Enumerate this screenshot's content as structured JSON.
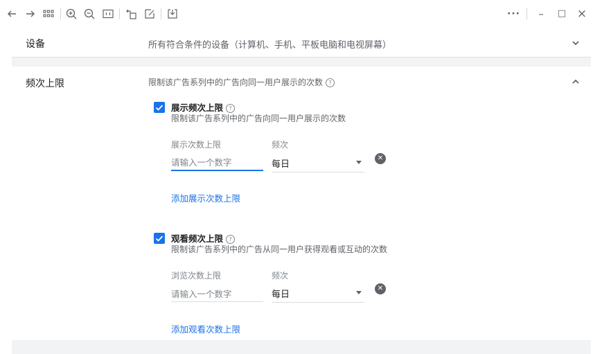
{
  "toolbar": {
    "back_icon": "arrow-left-icon",
    "forward_icon": "arrow-right-icon",
    "grid_icon": "grid-icon",
    "zoom_in_icon": "zoom-in-icon",
    "zoom_out_icon": "zoom-out-icon",
    "fit_icon": "fit-screen-icon",
    "rotate_icon": "rotate-icon",
    "edit_icon": "edit-icon",
    "save_icon": "save-icon",
    "more": "···",
    "minimize": "–",
    "maximize": "□",
    "close": "×"
  },
  "device_section": {
    "title": "设备",
    "description": "所有符合条件的设备（计算机、手机、平板电脑和电视屏幕）"
  },
  "frequency_section": {
    "title": "频次上限",
    "description": "限制该广告系列中的广告向同一用户展示的次数",
    "help": "?",
    "impression_cap": {
      "checked": true,
      "title": "展示频次上限",
      "help": "?",
      "description": "限制该广告系列中的广告向同一用户展示的次数",
      "count_label": "展示次数上限",
      "count_placeholder": "请输入一个数字",
      "frequency_label": "频次",
      "frequency_value": "每日",
      "remove_glyph": "✕",
      "add_link": "添加展示次数上限"
    },
    "view_cap": {
      "checked": true,
      "title": "观看频次上限",
      "help": "?",
      "description": "限制该广告系列中的广告从同一用户获得观看或互动的次数",
      "count_label": "浏览次数上限",
      "count_placeholder": "请输入一个数字",
      "frequency_label": "频次",
      "frequency_value": "每日",
      "remove_glyph": "✕",
      "add_link": "添加观看次数上限"
    }
  },
  "colors": {
    "accent": "#1a73e8",
    "text": "#202124",
    "muted": "#5f6368",
    "background": "#f1f3f4"
  }
}
